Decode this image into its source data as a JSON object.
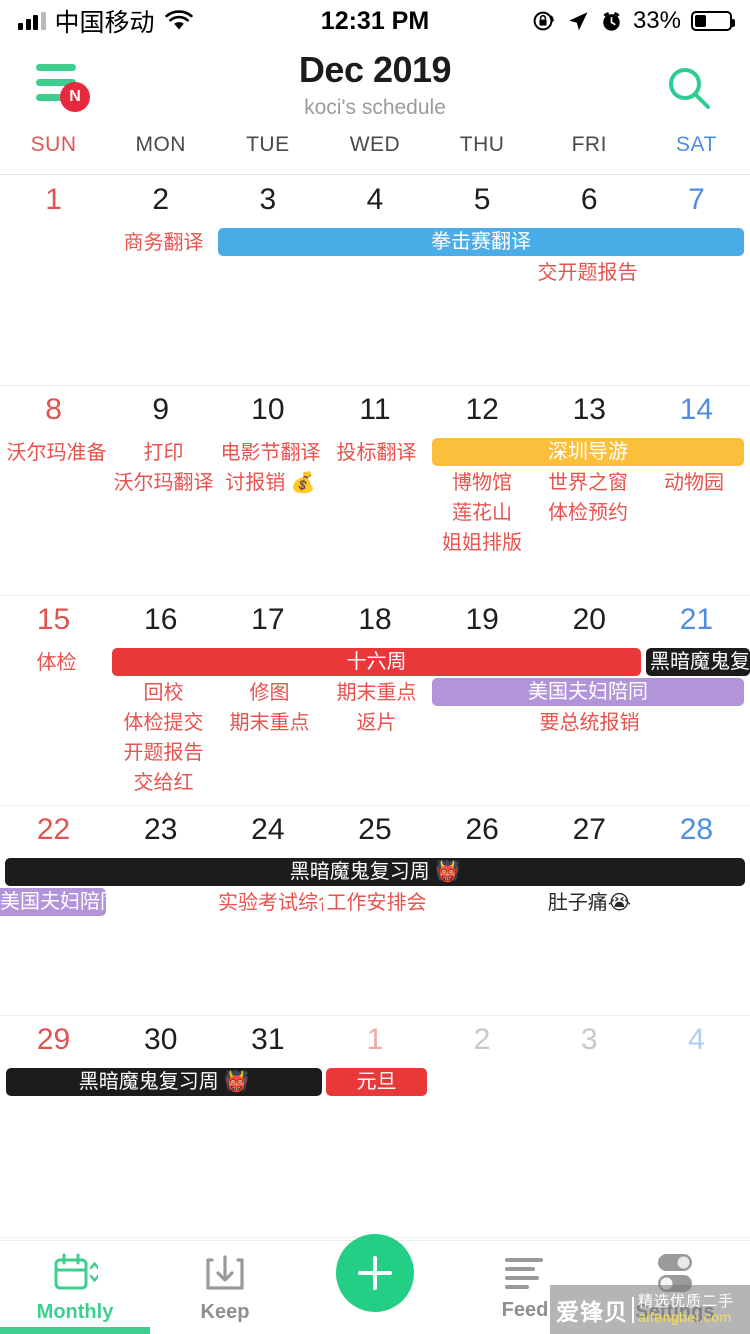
{
  "status_bar": {
    "carrier": "中国移动",
    "time": "12:31 PM",
    "battery_percent": "33%",
    "icons": [
      "signal-bars-icon",
      "wifi-icon",
      "rotation-lock-icon",
      "location-arrow-icon",
      "alarm-clock-icon",
      "battery-icon"
    ]
  },
  "header": {
    "title": "Dec 2019",
    "subtitle": "koci's schedule",
    "menu_badge": "N",
    "menu_icon": "hamburger-menu-icon",
    "search_icon": "search-icon"
  },
  "weekdays": [
    {
      "label": "SUN",
      "type": "sun"
    },
    {
      "label": "MON",
      "type": "weekday"
    },
    {
      "label": "TUE",
      "type": "weekday"
    },
    {
      "label": "WED",
      "type": "weekday"
    },
    {
      "label": "THU",
      "type": "weekday"
    },
    {
      "label": "FRI",
      "type": "weekday"
    },
    {
      "label": "SAT",
      "type": "sat"
    }
  ],
  "weeks": [
    {
      "days": [
        {
          "num": "1",
          "type": "sun"
        },
        {
          "num": "2",
          "type": "weekday"
        },
        {
          "num": "3",
          "type": "weekday"
        },
        {
          "num": "4",
          "type": "weekday"
        },
        {
          "num": "5",
          "type": "weekday"
        },
        {
          "num": "6",
          "type": "weekday"
        },
        {
          "num": "7",
          "type": "sat"
        }
      ],
      "texts": [
        {
          "label": "商务翻译",
          "color": "red"
        },
        {
          "label": "交开题报告",
          "color": "red"
        }
      ],
      "bars": [
        {
          "label": "拳击赛翻译",
          "color": "blue"
        }
      ]
    },
    {
      "days": [
        {
          "num": "8",
          "type": "sun"
        },
        {
          "num": "9",
          "type": "weekday"
        },
        {
          "num": "10",
          "type": "weekday"
        },
        {
          "num": "11",
          "type": "weekday"
        },
        {
          "num": "12",
          "type": "weekday"
        },
        {
          "num": "13",
          "type": "weekday"
        },
        {
          "num": "14",
          "type": "sat"
        }
      ],
      "texts": [
        {
          "label": "沃尔玛准备",
          "color": "red"
        },
        {
          "label": "打印",
          "color": "red"
        },
        {
          "label": "沃尔玛翻译",
          "color": "red"
        },
        {
          "label": "电影节翻译",
          "color": "red"
        },
        {
          "label": "讨报销 💰",
          "color": "red"
        },
        {
          "label": "投标翻译",
          "color": "red"
        },
        {
          "label": "博物馆",
          "color": "red"
        },
        {
          "label": "莲花山",
          "color": "red"
        },
        {
          "label": "姐姐排版",
          "color": "red"
        },
        {
          "label": "世界之窗",
          "color": "red"
        },
        {
          "label": "体检预约",
          "color": "red"
        },
        {
          "label": "动物园",
          "color": "red"
        }
      ],
      "bars": [
        {
          "label": "深圳导游",
          "color": "orange"
        }
      ]
    },
    {
      "days": [
        {
          "num": "15",
          "type": "sun"
        },
        {
          "num": "16",
          "type": "weekday"
        },
        {
          "num": "17",
          "type": "weekday"
        },
        {
          "num": "18",
          "type": "weekday"
        },
        {
          "num": "19",
          "type": "weekday"
        },
        {
          "num": "20",
          "type": "weekday"
        },
        {
          "num": "21",
          "type": "sat"
        }
      ],
      "texts": [
        {
          "label": "体检",
          "color": "red"
        },
        {
          "label": "回校",
          "color": "red"
        },
        {
          "label": "体检提交",
          "color": "red"
        },
        {
          "label": "开题报告",
          "color": "red"
        },
        {
          "label": "交给红",
          "color": "red"
        },
        {
          "label": "修图",
          "color": "red"
        },
        {
          "label": "期末重点",
          "color": "red"
        },
        {
          "label": "期末重点",
          "color": "red"
        },
        {
          "label": "返片",
          "color": "red"
        },
        {
          "label": "要总统报销",
          "color": "red"
        }
      ],
      "bars": [
        {
          "label": "十六周",
          "color": "red"
        },
        {
          "label": "黑暗魔鬼复习周 👹",
          "color": "black"
        },
        {
          "label": "美国夫妇陪同",
          "color": "purple"
        }
      ]
    },
    {
      "days": [
        {
          "num": "22",
          "type": "sun"
        },
        {
          "num": "23",
          "type": "weekday"
        },
        {
          "num": "24",
          "type": "weekday"
        },
        {
          "num": "25",
          "type": "weekday"
        },
        {
          "num": "26",
          "type": "weekday"
        },
        {
          "num": "27",
          "type": "weekday"
        },
        {
          "num": "28",
          "type": "sat"
        }
      ],
      "texts": [
        {
          "label": "实验考试综合",
          "color": "red"
        },
        {
          "label": "工作安排会",
          "color": "red"
        },
        {
          "label": "肚子痛😭",
          "color": "black"
        }
      ],
      "bars": [
        {
          "label": "黑暗魔鬼复习周 👹",
          "color": "black"
        },
        {
          "label": "美国夫妇陪同",
          "color": "purple"
        }
      ]
    },
    {
      "days": [
        {
          "num": "29",
          "type": "sun"
        },
        {
          "num": "30",
          "type": "weekday"
        },
        {
          "num": "31",
          "type": "weekday"
        },
        {
          "num": "1",
          "type": "sun-dim"
        },
        {
          "num": "2",
          "type": "dim"
        },
        {
          "num": "3",
          "type": "dim"
        },
        {
          "num": "4",
          "type": "sat-dim"
        }
      ],
      "texts": [],
      "bars": [
        {
          "label": "黑暗魔鬼复习周 👹",
          "color": "black"
        },
        {
          "label": "元旦",
          "color": "red"
        }
      ]
    }
  ],
  "tabbar": [
    {
      "label": "Monthly",
      "icon": "calendar-icon",
      "active": true
    },
    {
      "label": "Keep",
      "icon": "save-download-icon",
      "active": false
    },
    {
      "label": "",
      "icon": "plus-icon",
      "active": false
    },
    {
      "label": "Feed",
      "icon": "feed-lines-icon",
      "active": false
    },
    {
      "label": "Settings",
      "icon": "toggles-icon",
      "active": false
    }
  ],
  "watermark": {
    "main": "爱锋贝",
    "line1": "精选优质二手",
    "line2": "aifengbei.com"
  },
  "colors": {
    "accent_green": "#3ecf8e",
    "sunday_red": "#e0534f",
    "saturday_blue": "#4f8de0",
    "event_red": "#e8534e",
    "bar_blue": "#4aade8",
    "bar_orange": "#fcbf3c",
    "bar_red": "#e8383a",
    "bar_purple": "#b294da",
    "bar_black": "#1c1c1c"
  }
}
